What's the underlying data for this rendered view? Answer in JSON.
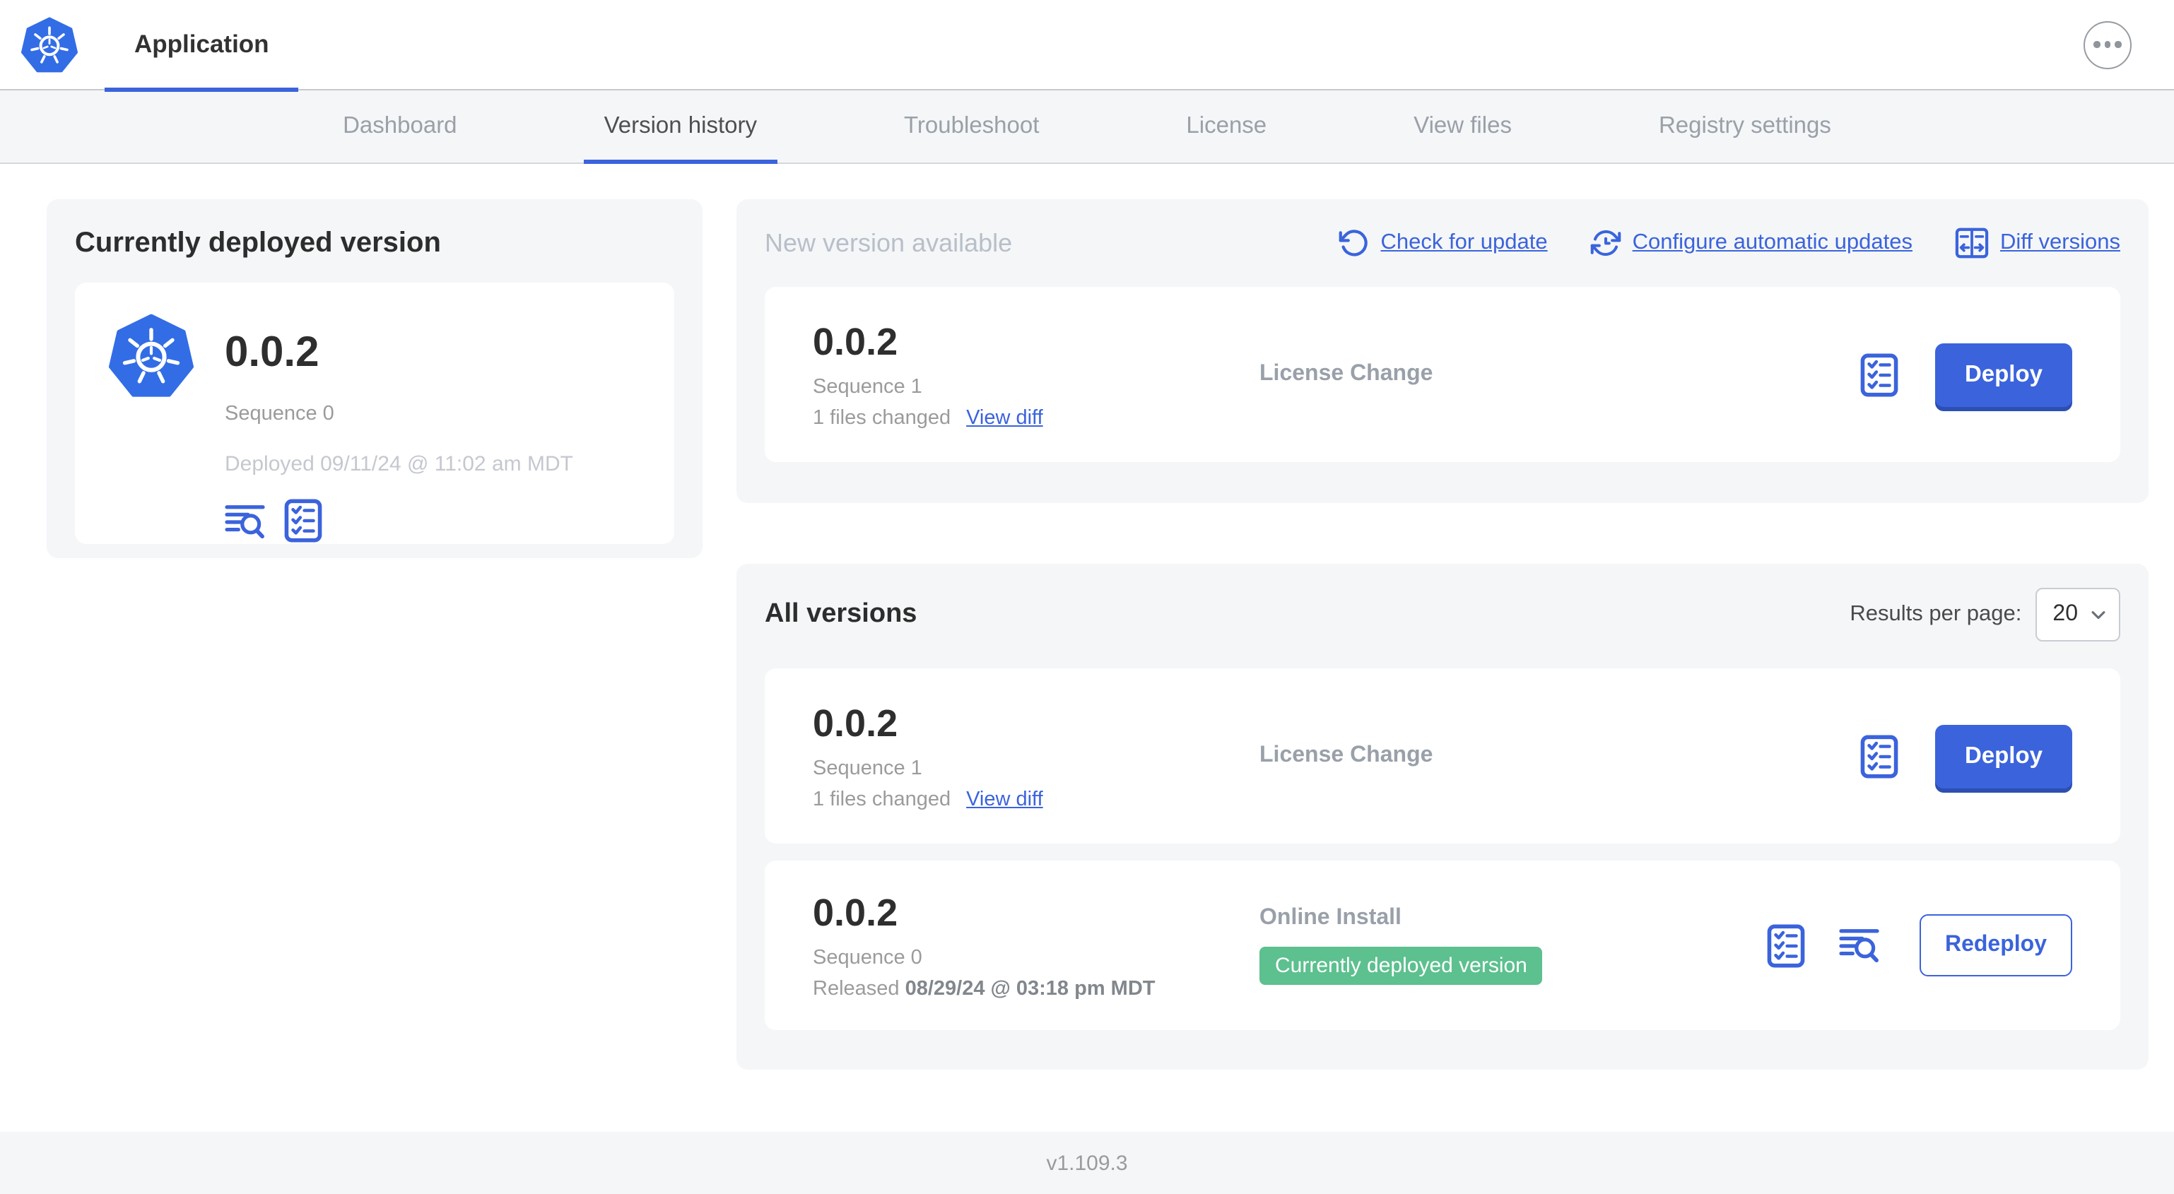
{
  "header": {
    "app_title": "Application"
  },
  "nav": {
    "tabs": [
      "Dashboard",
      "Version history",
      "Troubleshoot",
      "License",
      "View files",
      "Registry settings"
    ],
    "active_tab": "Version history"
  },
  "current": {
    "title": "Currently deployed version",
    "version": "0.0.2",
    "sequence": "Sequence 0",
    "deployed": "Deployed 09/11/24 @ 11:02 am MDT"
  },
  "new_version": {
    "title": "New version available",
    "check_for_update": "Check for update",
    "configure_automatic_updates": "Configure automatic updates",
    "diff_versions": "Diff versions",
    "card": {
      "version": "0.0.2",
      "sequence": "Sequence 1",
      "files_changed": "1 files changed",
      "view_diff": "View diff",
      "source": "License Change",
      "action": "Deploy"
    }
  },
  "all_versions": {
    "title": "All versions",
    "results_per_page_label": "Results per page:",
    "results_per_page_value": "20",
    "rows": [
      {
        "version": "0.0.2",
        "sequence": "Sequence 1",
        "files_changed": "1 files changed",
        "view_diff": "View diff",
        "source": "License Change",
        "action": "Deploy"
      },
      {
        "version": "0.0.2",
        "sequence": "Sequence 0",
        "released_label": "Released",
        "released_date": "08/29/24 @ 03:18 pm MDT",
        "source": "Online Install",
        "badge": "Currently deployed version",
        "action": "Redeploy"
      }
    ]
  },
  "footer": {
    "app_version": "v1.109.3"
  },
  "colors": {
    "accent_blue": "#3B63DC",
    "kubernetes_blue": "#326DE6",
    "badge_green": "#5CC08F",
    "panel_gray": "#F4F6F8"
  }
}
